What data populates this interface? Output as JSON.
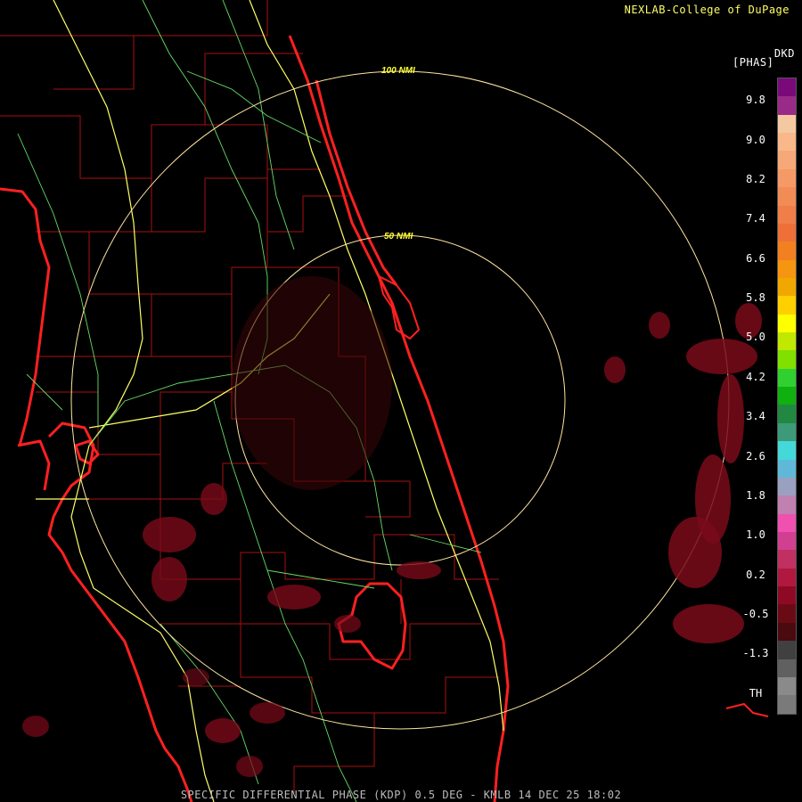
{
  "header": {
    "credit": "NEXLAB-College of DuPage",
    "unit_code": "DKD",
    "unit_name": "[PHAS]"
  },
  "footer": {
    "caption": "SPECIFIC DIFFERENTIAL PHASE (KDP) 0.5 DEG - KMLB 14 DEC 25 18:02"
  },
  "range_rings": [
    {
      "label": "100 NMI"
    },
    {
      "label": "50 NMI"
    }
  ],
  "legend": {
    "ticks": [
      "9.8",
      "9.0",
      "8.2",
      "7.4",
      "6.6",
      "5.8",
      "5.0",
      "4.2",
      "3.4",
      "2.6",
      "1.8",
      "1.0",
      "0.2",
      "-0.5",
      "-1.3",
      "TH"
    ],
    "colors": [
      "#7a0a7a",
      "#9a2a88",
      "#f4c8a0",
      "#f8b88a",
      "#f7a878",
      "#f59a66",
      "#f28c56",
      "#f07e48",
      "#ee7038",
      "#f28020",
      "#f59510",
      "#f0a800",
      "#ffd000",
      "#ffff00",
      "#c0e800",
      "#80e000",
      "#30d030",
      "#10b010",
      "#208840",
      "#3c9a78",
      "#44d8d8",
      "#5fb8d8",
      "#9aa0c0",
      "#c080b0",
      "#f050b0",
      "#d04090",
      "#c03060",
      "#b01840",
      "#8e0a24",
      "#6a0a14",
      "#4a0a10",
      "#404040",
      "#606060",
      "#8a8a8a",
      "#7a7a7a"
    ],
    "fill_colors": {
      "range_ring": "#ffe6a0",
      "coast": "#ff2020",
      "county": "#b01010",
      "highway": "#ffff66",
      "road": "#66dd66"
    }
  }
}
